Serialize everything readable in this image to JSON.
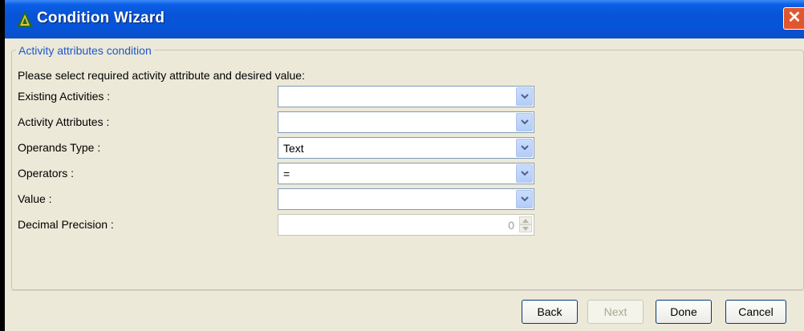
{
  "window": {
    "title": "Condition Wizard",
    "close_glyph": "✕"
  },
  "group": {
    "legend": "Activity attributes condition",
    "instruction": "Please select required activity attribute and desired value:"
  },
  "fields": {
    "existing_activities": {
      "label": "Existing Activities :",
      "value": ""
    },
    "activity_attributes": {
      "label": "Activity Attributes :",
      "value": ""
    },
    "operands_type": {
      "label": "Operands Type :",
      "value": "Text"
    },
    "operators": {
      "label": "Operators :",
      "value": "="
    },
    "value": {
      "label": "Value :",
      "value": ""
    },
    "decimal_precision": {
      "label": "Decimal Precision :",
      "value": "0"
    }
  },
  "buttons": {
    "back": "Back",
    "next": "Next",
    "done": "Done",
    "cancel": "Cancel"
  },
  "colors": {
    "titlebar": "#0853d6",
    "legend_text": "#1f57c8",
    "close_button": "#e0572f"
  }
}
